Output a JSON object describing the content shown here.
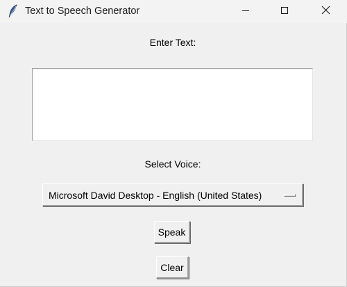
{
  "window": {
    "title": "Text to Speech Generator",
    "controls": {
      "minimize_icon": "minimize-icon",
      "maximize_icon": "maximize-icon",
      "close_icon": "close-icon"
    },
    "app_icon": "feather-icon"
  },
  "main": {
    "text_label": "Enter Text:",
    "text_value": "",
    "voice_label": "Select Voice:",
    "voice_selected": "Microsoft David Desktop - English (United States)",
    "speak_label": "Speak",
    "clear_label": "Clear"
  }
}
